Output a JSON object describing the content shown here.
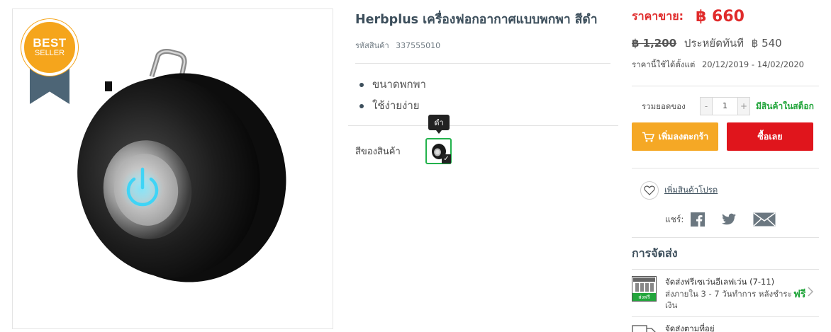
{
  "product": {
    "title": "Herbplus เครื่องฟอกอากาศแบบพกพา สีดำ",
    "sku_label": "รหัสสินค้า",
    "sku": "337555010",
    "badge_line1": "BEST",
    "badge_line2": "SELLER",
    "features": [
      "ขนาดพกพา",
      "ใช้ง่ายง่าย"
    ],
    "color_label": "สีของสินค้า",
    "color_tooltip": "ดำ",
    "swatch_check": "✓"
  },
  "pricing": {
    "price_label": "ราคาขาย:",
    "price": "฿ 660",
    "old_price": "฿ 1,200",
    "save_label": "ประหยัดทันที",
    "save_amount": "฿ 540",
    "valid_label": "ราคานี้ใช้ได้ตั้งแต่",
    "valid_range": "20/12/2019 - 14/02/2020"
  },
  "purchase": {
    "qty_label": "รวมยอดของ",
    "qty_minus": "-",
    "qty_value": "1",
    "qty_plus": "+",
    "stock_status": "มีสินค้าในสต็อก",
    "add_to_cart": "เพิ่มลงตะกร้า",
    "buy_now": "ซื้อเลย",
    "wishlist": "เพิ่มสินค้าโปรด",
    "share_label": "แชร์:"
  },
  "shipping": {
    "title": "การจัดส่ง",
    "options": [
      {
        "name": "จัดส่งฟรีเซเว่นอีเลฟเว่น (7-11)",
        "description": "ส่งภายใน 3 - 7 วันทำการ หลังชำระเงิน",
        "price": "ฟรี",
        "icon_caption": "ส่งฟรี",
        "icon": "seven-eleven-store-icon"
      },
      {
        "name": "จัดส่งตามที่อยู่",
        "icon": "delivery-truck-icon"
      }
    ]
  },
  "colors": {
    "price_red": "#e02b2b",
    "cart_orange": "#f5a825",
    "buy_red": "#e0151c",
    "stock_green": "#22a53b",
    "badge_orange": "#f5a51c",
    "badge_ribbon": "#4d6576",
    "swatch_border": "#22b24c"
  },
  "icons": {
    "cart": "shopping-cart-icon",
    "wishlist": "heart-icon",
    "share": [
      "facebook-icon",
      "twitter-icon",
      "email-icon"
    ],
    "chevron": "chevron-right-icon",
    "product": "power-button-icon"
  }
}
